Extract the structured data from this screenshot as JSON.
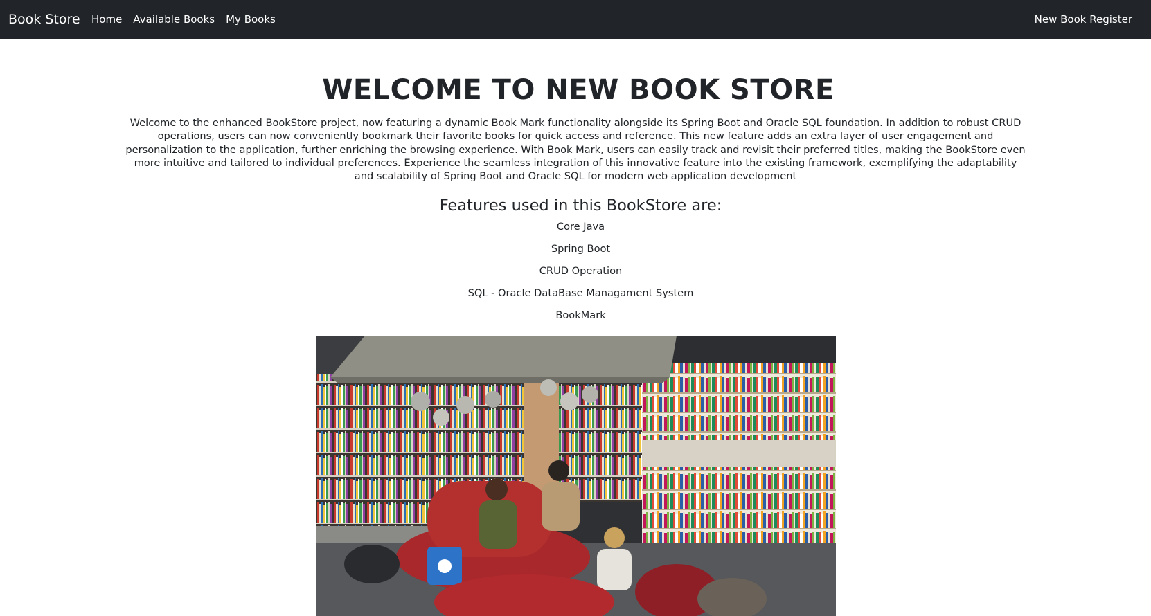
{
  "navbar": {
    "brand": "Book Store",
    "links": [
      {
        "label": "Home"
      },
      {
        "label": "Available Books"
      },
      {
        "label": "My Books"
      }
    ],
    "right_link": "New Book Register",
    "background": "#212529"
  },
  "hero": {
    "title": "WELCOME TO NEW BOOK STORE",
    "intro": "Welcome to the enhanced BookStore project, now featuring a dynamic Book Mark functionality alongside its Spring Boot and Oracle SQL foundation. In addition to robust CRUD operations, users can now conveniently bookmark their favorite books for quick access and reference. This new feature adds an extra layer of user engagement and personalization to the application, further enriching the browsing experience. With Book Mark, users can easily track and revisit their preferred titles, making the BookStore even more intuitive and tailored to individual preferences. Experience the seamless integration of this innovative feature into the existing framework, exemplifying the adaptability and scalability of Spring Boot and Oracle SQL for modern web application development"
  },
  "features": {
    "title": "Features used in this BookStore are:",
    "items": [
      "Core Java",
      "Spring Boot",
      "CRUD Operation",
      "SQL - Oracle DataBase Managament System",
      "BookMark"
    ]
  },
  "photo": {
    "icon": "bookstore-photo"
  }
}
